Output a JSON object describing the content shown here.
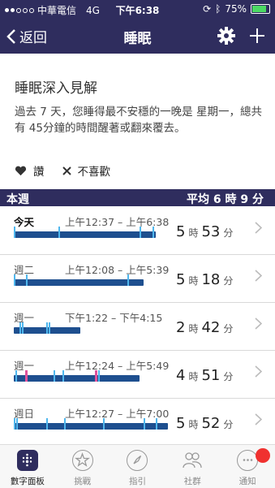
{
  "status_bar": {
    "carrier": "中華電信",
    "network": "4G",
    "time": "下午6:38",
    "battery": "75%"
  },
  "nav": {
    "back_label": "返回",
    "title": "睡眠"
  },
  "insight": {
    "title": "睡眠深入見解",
    "body": "過去 7 天，您睡得最不安穩的一晚是 星期一，總共有 45分鐘的時間醒著或翻來覆去。",
    "like_label": "讚",
    "dislike_label": "不喜歡"
  },
  "week": {
    "label": "本週",
    "average": "平均 6 時 9 分"
  },
  "rows": [
    {
      "day": "今天",
      "range": "上午12:37 – 上午6:38",
      "hours": "5",
      "hours_unit": "時",
      "minutes": "53",
      "minutes_unit": "分"
    },
    {
      "day": "週二",
      "range": "上午12:08 – 上午5:39",
      "hours": "5",
      "hours_unit": "時",
      "minutes": "18",
      "minutes_unit": "分"
    },
    {
      "day": "週一",
      "range": "下午1:22 – 下午4:15",
      "hours": "2",
      "hours_unit": "時",
      "minutes": "42",
      "minutes_unit": "分"
    },
    {
      "day": "週一",
      "range": "上午12:24 – 上午5:49",
      "hours": "4",
      "hours_unit": "時",
      "minutes": "51",
      "minutes_unit": "分"
    },
    {
      "day": "週日",
      "range": "上午12:27 – 上午7:00",
      "hours": "5",
      "hours_unit": "時",
      "minutes": "52",
      "minutes_unit": "分"
    }
  ],
  "tabs": [
    {
      "label": "數字面板",
      "icon": "dashboard-icon"
    },
    {
      "label": "挑戰",
      "icon": "star-icon"
    },
    {
      "label": "指引",
      "icon": "compass-icon"
    },
    {
      "label": "社群",
      "icon": "people-icon"
    },
    {
      "label": "通知",
      "icon": "chat-icon"
    }
  ],
  "colors": {
    "nav": "#2f2d5e",
    "sleep_bar": "#1e4f8f",
    "awake_tick": "#4fb7ee",
    "restless_tick": "#e0529c",
    "badge": "#f0312f"
  }
}
